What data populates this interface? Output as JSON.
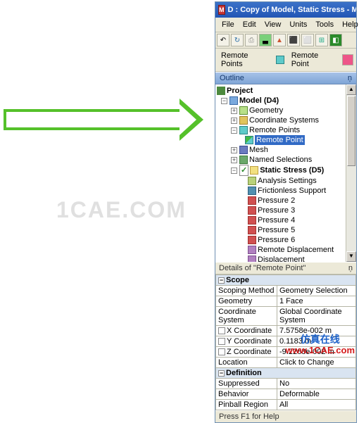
{
  "titlebar": {
    "icon_letter": "M",
    "title": "D : Copy of Model, Static Stress - Mechanica"
  },
  "menu": {
    "file": "File",
    "edit": "Edit",
    "view": "View",
    "units": "Units",
    "tools": "Tools",
    "help": "Help"
  },
  "toolbar2": {
    "label1": "Remote Points",
    "label2": "Remote Point"
  },
  "outline": {
    "title": "Outline",
    "pin": "ņ",
    "project": "Project",
    "model": "Model (D4)",
    "geometry": "Geometry",
    "cs": "Coordinate Systems",
    "remote_points": "Remote Points",
    "remote_point": "Remote Point",
    "mesh": "Mesh",
    "named_selections": "Named Selections",
    "static": "Static Stress (D5)",
    "analysis_settings": "Analysis Settings",
    "frictionless": "Frictionless Support",
    "p2": "Pressure 2",
    "p3": "Pressure 3",
    "p4": "Pressure 4",
    "p5": "Pressure 5",
    "p6": "Pressure 6",
    "remote_disp": "Remote Displacement",
    "disp": "Displacement"
  },
  "details": {
    "title": "Details of \"Remote Point\"",
    "pin": "ņ",
    "groups": {
      "scope": "Scope",
      "definition": "Definition"
    },
    "rows": {
      "scoping_method": {
        "k": "Scoping Method",
        "v": "Geometry Selection"
      },
      "geometry": {
        "k": "Geometry",
        "v": "1 Face"
      },
      "cs": {
        "k": "Coordinate System",
        "v": "Global Coordinate System"
      },
      "x": {
        "k": "X Coordinate",
        "v": "7.5758e-002 m"
      },
      "y": {
        "k": "Y Coordinate",
        "v": "0.1183 m"
      },
      "z": {
        "k": "Z Coordinate",
        "v": "-9.2268e-002 m"
      },
      "location": {
        "k": "Location",
        "v": "Click to Change"
      },
      "suppressed": {
        "k": "Suppressed",
        "v": "No"
      },
      "behavior": {
        "k": "Behavior",
        "v": "Deformable"
      },
      "pinball": {
        "k": "Pinball Region",
        "v": "All"
      }
    }
  },
  "status": "Press F1 for Help",
  "watermark": {
    "bg": "1CAE.COM",
    "cn": "仿真在线",
    "url": "www.1CAE.com"
  }
}
